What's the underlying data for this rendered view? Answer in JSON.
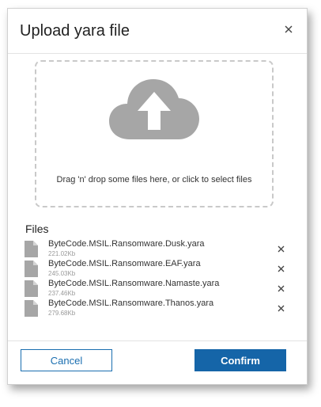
{
  "dialog": {
    "title": "Upload yara file",
    "close_icon": "close-icon"
  },
  "dropzone": {
    "icon": "cloud-upload-icon",
    "instructions": "Drag 'n' drop some files here, or click to select files"
  },
  "files": {
    "heading": "Files",
    "items": [
      {
        "name": "ByteCode.MSIL.Ransomware.Dusk.yara",
        "size": "221.02Kb"
      },
      {
        "name": "ByteCode.MSIL.Ransomware.EAF.yara",
        "size": "245.03Kb"
      },
      {
        "name": "ByteCode.MSIL.Ransomware.Namaste.yara",
        "size": "237.46Kb"
      },
      {
        "name": "ByteCode.MSIL.Ransomware.Thanos.yara",
        "size": "279.68Kb"
      }
    ]
  },
  "footer": {
    "cancel_label": "Cancel",
    "confirm_label": "Confirm"
  },
  "colors": {
    "primary": "#1565a8",
    "icon_gray": "#a6a6a6",
    "border": "#c9c9c9"
  }
}
